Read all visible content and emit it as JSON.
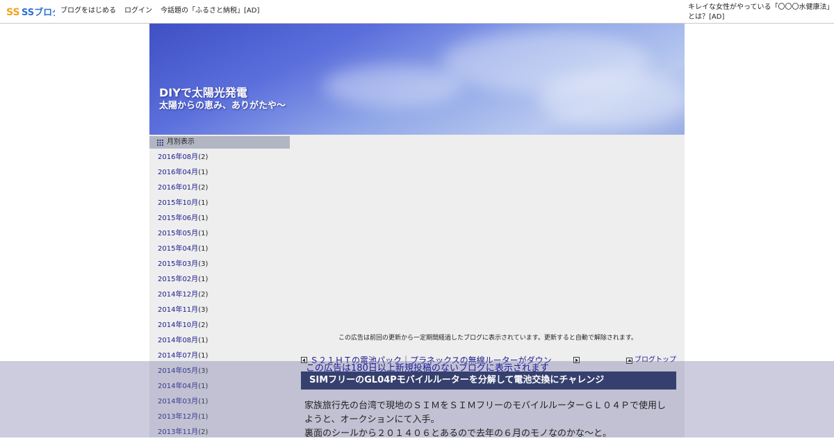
{
  "topbar": {
    "logo": "SSブログ",
    "links": [
      "ブログをはじめる",
      "ログイン",
      "今話題の「ふるさと納税」[AD]"
    ],
    "right_ad": "キレイな女性がやっている「〇〇〇水健康法」とは？[AD]"
  },
  "banner": {
    "title": "DIYで太陽光発電",
    "subtitle": "太陽からの恵み、ありがたや～"
  },
  "sidebar": {
    "heading": "月別表示",
    "archives": [
      {
        "month": "2016年08月",
        "count": "(2)"
      },
      {
        "month": "2016年04月",
        "count": "(1)"
      },
      {
        "month": "2016年01月",
        "count": "(2)"
      },
      {
        "month": "2015年10月",
        "count": "(1)"
      },
      {
        "month": "2015年06月",
        "count": "(1)"
      },
      {
        "month": "2015年05月",
        "count": "(1)"
      },
      {
        "month": "2015年04月",
        "count": "(1)"
      },
      {
        "month": "2015年03月",
        "count": "(3)"
      },
      {
        "month": "2015年02月",
        "count": "(1)"
      },
      {
        "month": "2014年12月",
        "count": "(2)"
      },
      {
        "month": "2014年11月",
        "count": "(3)"
      },
      {
        "month": "2014年10月",
        "count": "(2)"
      },
      {
        "month": "2014年08月",
        "count": "(1)"
      },
      {
        "month": "2014年07月",
        "count": "(1)"
      },
      {
        "month": "2014年05月",
        "count": "(3)"
      },
      {
        "month": "2014年04月",
        "count": "(1)"
      },
      {
        "month": "2014年03月",
        "count": "(1)"
      },
      {
        "month": "2013年12月",
        "count": "(1)"
      },
      {
        "month": "2013年11月",
        "count": "(2)"
      }
    ]
  },
  "main": {
    "ad_note": "この広告は前回の更新から一定期間経過したブログに表示されています。更新すると自動で解除されます。",
    "prev_link": "Ｓ２１ＨＴの電池パック｜プラネックスの無線ルーターがダウン",
    "blog_top": "ブログトップ",
    "post_title": "SIMフリーのGL04Pモバイルルーターを分解して電池交換にチャレンジ",
    "post_lines": [
      "家族旅行先の台湾で現地のＳＩＭをＳＩＭフリーのモバイルルーターＧＬ０４Ｐで使用しようと、オークションにて入手。",
      "裏面のシールから２０１４０６とあるので去年の６月のモノなのかな～と。"
    ]
  },
  "overlay": {
    "note": "この広告は180日以上新規投稿のないブログに表示されます"
  },
  "colors": {
    "logo_orange": "#f4a21c",
    "logo_blue": "#2c6fd4",
    "title_bar": "#36406e",
    "link": "#1a1a8a"
  }
}
